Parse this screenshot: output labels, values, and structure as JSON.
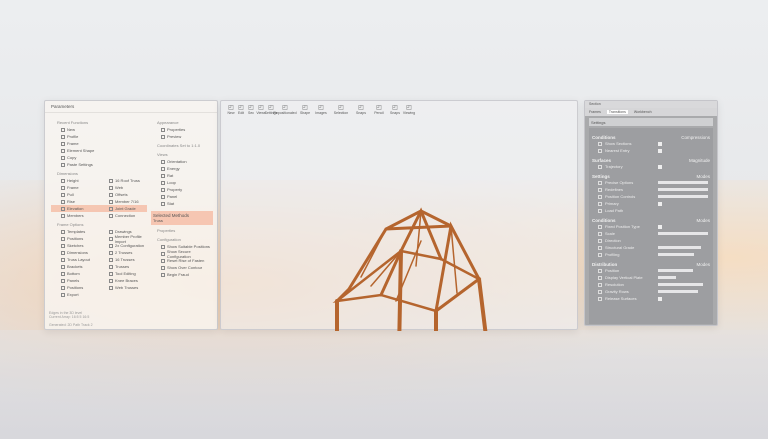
{
  "left_panel": {
    "title": "Parameters",
    "quick_functions": {
      "label": "Recent Functions",
      "items": [
        "New",
        "Profile",
        "Frame",
        "Element Shape",
        "Copy",
        "Paste Settings"
      ]
    },
    "appearance": {
      "label": "Appearance",
      "items": [
        "Properties",
        "Preview"
      ],
      "note": "Coordinates Set to 1:1.0"
    },
    "sections": {
      "label": "Dimensions",
      "col1": [
        "Height",
        "Frame",
        "Pull",
        "Rise",
        "Elevation",
        "Members"
      ],
      "col2": [
        "16 Roof Truss",
        "Web",
        "Offsets",
        "Member 7/16",
        "Joint Grade",
        "Connection"
      ]
    },
    "view": {
      "label": "Views",
      "items": [
        "Orientation",
        "Energy",
        "Rat",
        "Loop",
        "Property",
        "Panel",
        "Stat"
      ]
    },
    "frame_options": {
      "label": "Frame Options",
      "col1": [
        "Templates",
        "Positions",
        "Sketches",
        "Dimensions",
        "Truss Layout",
        "Brackets",
        "Bottom",
        "Panels",
        "Positions",
        "Export"
      ],
      "col2": [
        "Drawings",
        "Member Profile Import",
        "2x Configuration",
        "2 Trusses",
        "16 Trusses",
        "Trusses",
        "Tool Editing",
        "Knee Braces",
        "Web Trusses"
      ]
    },
    "selected_methods": {
      "label": "Selected Methods",
      "dropdown": "Truss"
    },
    "properties": {
      "label": "Properties",
      "sub": "Configuration",
      "items": [
        "Show Suitable Positions",
        "Show Secure Configuration",
        "Reset Rise of Fasten",
        "Show Over Contour",
        "Begin Fraud"
      ]
    },
    "footer": [
      "Edges in the 3D level",
      "Current Array: 16:5 5 16:5"
    ],
    "status": "Generated: 2D Path Track 2"
  },
  "toolbar": [
    "New",
    "Edit",
    "Sec",
    "Views",
    "Settings",
    "Repositionaled",
    "Shape",
    "Images",
    "Selection",
    "Snaps",
    "Pencil",
    "Snaps",
    "Viewing"
  ],
  "right_panel": {
    "title": "Section",
    "tabs": [
      "Frames",
      "Transitions",
      "Workbench"
    ],
    "filter": "Settings",
    "groups": [
      {
        "name": "Conditions",
        "meta": "Compressions",
        "rows": [
          {
            "label": "Show Sections",
            "type": "check"
          },
          {
            "label": "Nearest Entry",
            "type": "check"
          }
        ]
      },
      {
        "name": "Surfaces",
        "meta": "Magnitude",
        "rows": [
          {
            "label": "Trajectory",
            "type": "check"
          }
        ]
      },
      {
        "name": "Settings",
        "meta": "Modes",
        "rows": [
          {
            "label": "Precise Options",
            "type": "bar",
            "value": 1.0
          },
          {
            "label": "Redefines",
            "type": "bar",
            "value": 1.0
          },
          {
            "label": "Position Controls",
            "type": "bar",
            "value": 1.0
          },
          {
            "label": "Primary",
            "type": "check"
          },
          {
            "label": "Load Path",
            "type": "none"
          }
        ]
      },
      {
        "name": "Conditions",
        "meta": "Modes",
        "rows": [
          {
            "label": "Fixed Position Type",
            "type": "check"
          },
          {
            "label": "Scale",
            "type": "bar",
            "value": 1.0
          },
          {
            "label": "Direction",
            "type": "none"
          },
          {
            "label": "Structural Grade",
            "type": "bar",
            "value": 0.85
          },
          {
            "label": "Profiling",
            "type": "bar",
            "value": 0.72
          }
        ]
      },
      {
        "name": "Distribution",
        "meta": "Modes",
        "rows": [
          {
            "label": "Position",
            "type": "bar",
            "value": 0.7
          },
          {
            "label": "Display Vertical Plate",
            "type": "bar",
            "value": 0.35
          },
          {
            "label": "Resolution",
            "type": "bar",
            "value": 0.9
          },
          {
            "label": "Gravity Rows",
            "type": "bar",
            "value": 0.8
          },
          {
            "label": "Release Surfaces",
            "type": "check"
          }
        ]
      }
    ]
  },
  "colors": {
    "accent": "#f3a98c",
    "wood": "#b5652e",
    "panel_gray": "#9d9ea1"
  }
}
